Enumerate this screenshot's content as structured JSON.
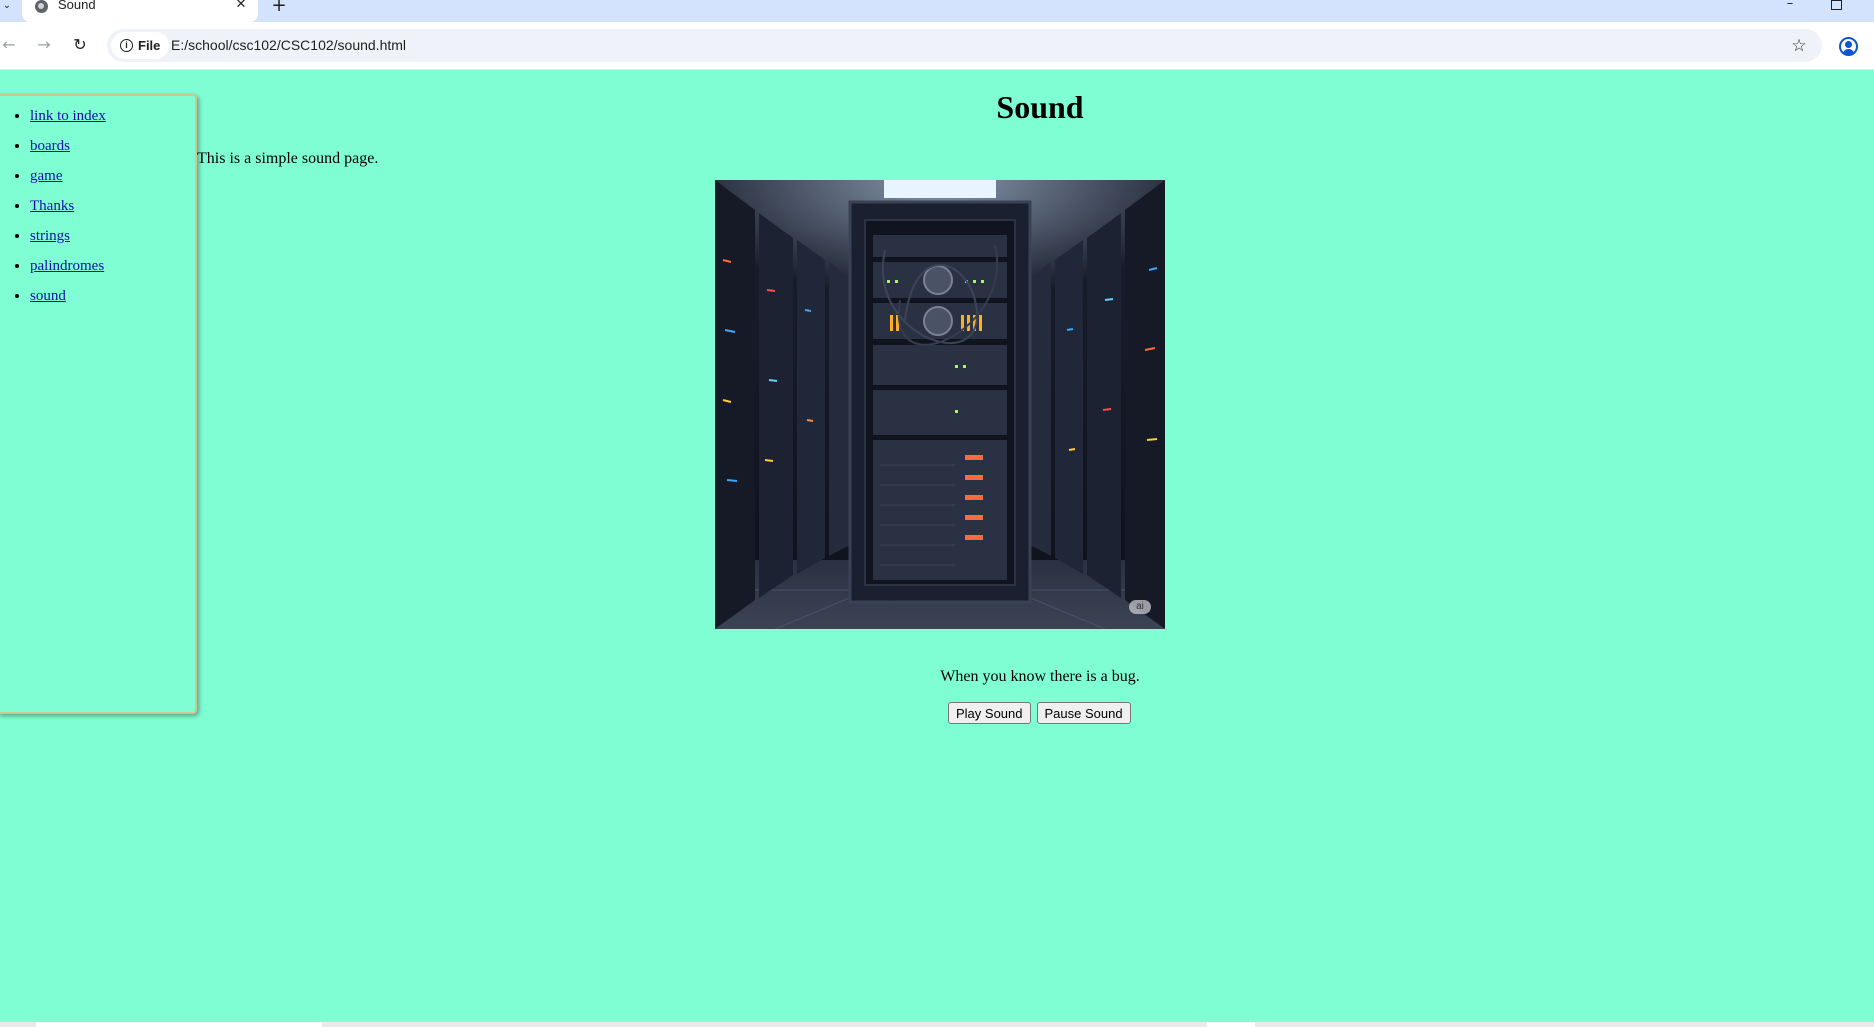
{
  "browser": {
    "tab_title": "Sound",
    "close_glyph": "✕",
    "new_tab_glyph": "+",
    "address_chip": "File",
    "url": "E:/school/csc102/CSC102/sound.html"
  },
  "icons": {
    "favicon": "globe-icon",
    "tab_menu": "chevron-down-icon",
    "back": "arrow-left-icon",
    "forward": "arrow-right-icon",
    "reload": "reload-icon",
    "site_info": "info-icon",
    "bookmark": "star-icon",
    "profile": "profile-icon"
  },
  "sidebar": {
    "items": [
      {
        "label": "link to index"
      },
      {
        "label": "boards"
      },
      {
        "label": "game"
      },
      {
        "label": "Thanks"
      },
      {
        "label": "strings"
      },
      {
        "label": "palindromes"
      },
      {
        "label": "sound"
      }
    ]
  },
  "page": {
    "title": "Sound",
    "intro": "This is a simple sound page.",
    "image_badge": "ai",
    "caption": "When you know there is a bug.",
    "play_label": "Play Sound",
    "pause_label": "Pause Sound"
  },
  "colors": {
    "page_background": "#7ffed4",
    "sidebar_border": "#d2c58e",
    "link": "#1a0dab",
    "tabbar": "#d3e3fd"
  }
}
